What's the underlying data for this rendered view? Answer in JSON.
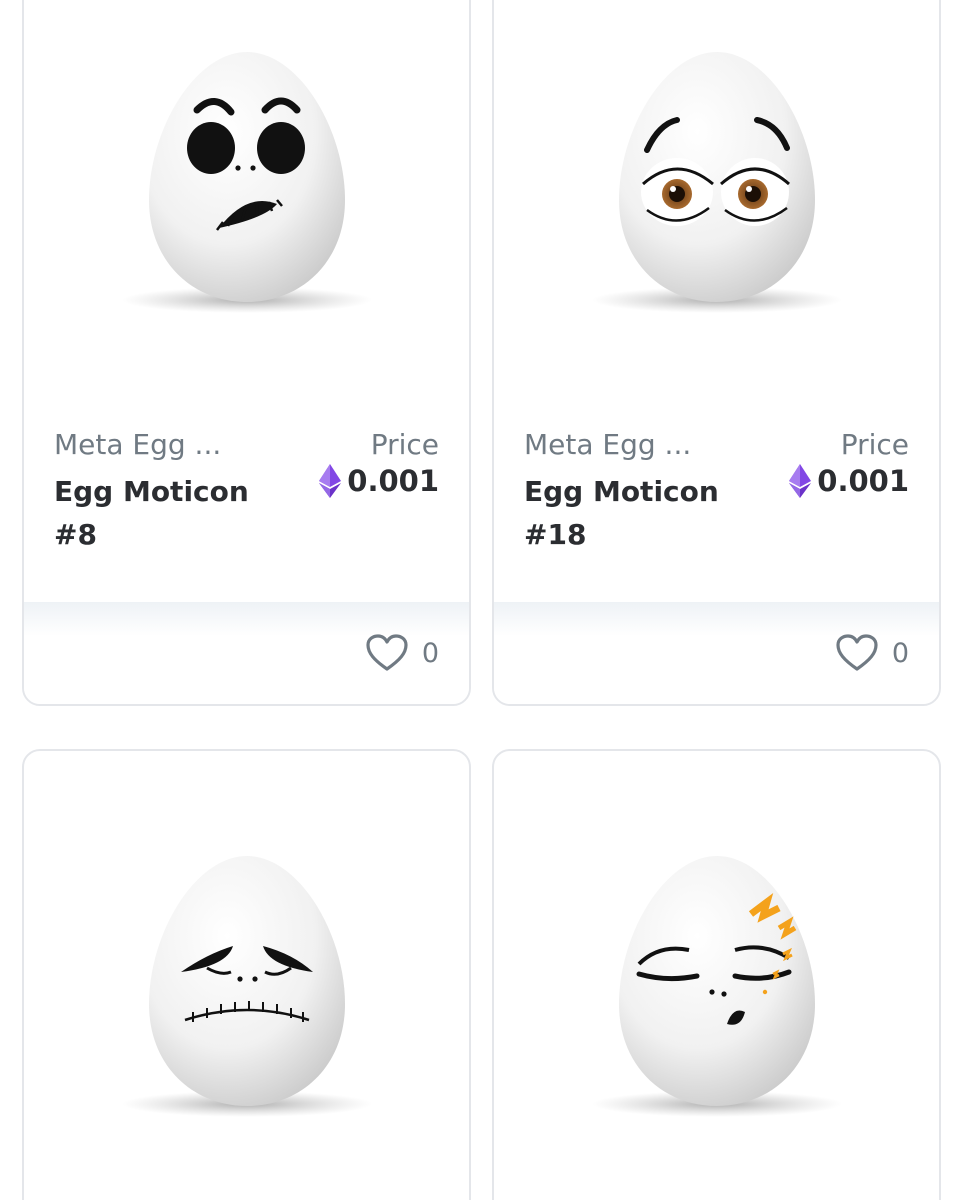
{
  "cards": [
    {
      "collection": "Meta Egg ...",
      "name": "Egg Moticon #8",
      "price_label": "Price",
      "price": "0.001",
      "currency_icon": "ethereum-icon",
      "likes": "0",
      "art": "egg-frightened-stitched-mouth"
    },
    {
      "collection": "Meta Egg ...",
      "name": "Egg Moticon #18",
      "price_label": "Price",
      "price": "0.001",
      "currency_icon": "ethereum-icon",
      "likes": "0",
      "art": "egg-surprised-brown-eyes"
    },
    {
      "art": "egg-sad-stitched-mouth"
    },
    {
      "art": "egg-sleeping-zzz"
    }
  ],
  "colors": {
    "accent_eth": "#8247e5",
    "text_primary": "#2b2d31",
    "text_secondary": "#707a83",
    "card_border": "#e4e6ea",
    "zzz_orange": "#f4a21c"
  }
}
